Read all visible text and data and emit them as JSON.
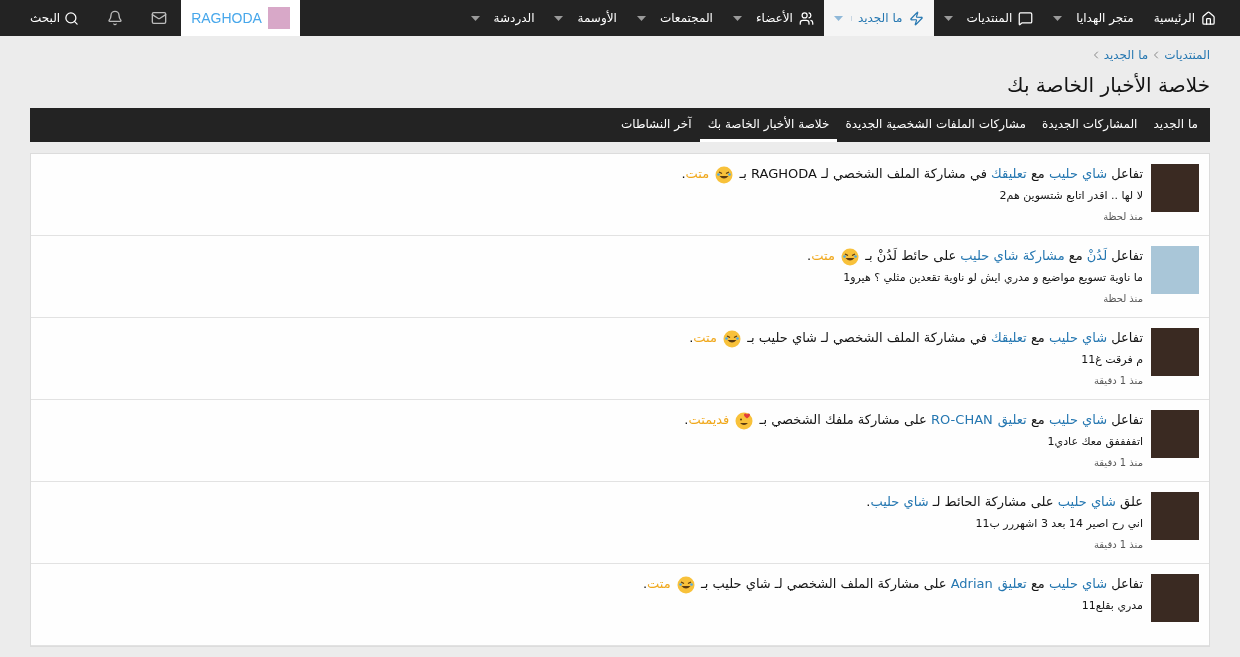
{
  "nav": {
    "items": [
      {
        "label": "الرئيسية",
        "kind": "home",
        "caret": false,
        "selected": false
      },
      {
        "label": "متجر الهدايا",
        "kind": "plain",
        "caret": true,
        "selected": false
      },
      {
        "label": "المنتديات",
        "kind": "forums",
        "caret": true,
        "selected": false
      },
      {
        "label": "ما الجديد",
        "kind": "new",
        "caret": true,
        "selected": true
      },
      {
        "label": "الأعضاء",
        "kind": "members",
        "caret": true,
        "selected": false
      },
      {
        "label": "المجتمعات",
        "kind": "plain",
        "caret": true,
        "selected": false
      },
      {
        "label": "الأوسمة",
        "kind": "plain",
        "caret": true,
        "selected": false
      },
      {
        "label": "الدردشة",
        "kind": "plain",
        "caret": true,
        "selected": false
      }
    ],
    "user": "RAGHODA",
    "search": "البحث"
  },
  "breadcrumbs": [
    "المنتديات",
    "ما الجديد"
  ],
  "title": "خلاصة الأخبار الخاصة بك",
  "tabs": [
    {
      "label": "ما الجديد",
      "selected": false
    },
    {
      "label": "المشاركات الجديدة",
      "selected": false
    },
    {
      "label": "مشاركات الملفات الشخصية الجديدة",
      "selected": false
    },
    {
      "label": "خلاصة الأخبار الخاصة بك",
      "selected": true
    },
    {
      "label": "آخر النشاطات",
      "selected": false
    }
  ],
  "feed": [
    {
      "parts": [
        {
          "kind": "plain",
          "text": "تفاعل "
        },
        {
          "kind": "link",
          "text": "شاي حليب"
        },
        {
          "kind": "plain",
          "text": " مع "
        },
        {
          "kind": "link",
          "text": "تعليقك"
        },
        {
          "kind": "plain",
          "text": " في مشاركة الملف الشخصي لـ RAGHODA بـ "
        },
        {
          "kind": "laugh-emoji"
        },
        {
          "kind": "reaction",
          "text": " متت"
        },
        {
          "kind": "plain",
          "text": "."
        }
      ],
      "snippet": "لا لها .. اقدر اتابع شتسوين هم2",
      "time": "منذ لحظة"
    },
    {
      "parts": [
        {
          "kind": "plain",
          "text": "تفاعل "
        },
        {
          "kind": "link",
          "text": "لَدُنْ"
        },
        {
          "kind": "plain",
          "text": " مع "
        },
        {
          "kind": "link",
          "text": "مشاركة شاي حليب"
        },
        {
          "kind": "plain",
          "text": " على حائط لَدُنْ بـ "
        },
        {
          "kind": "laugh-emoji"
        },
        {
          "kind": "reaction",
          "text": " متت"
        },
        {
          "kind": "plain",
          "text": "."
        }
      ],
      "snippet": "ما ناوية تسويع مواضيع و مدري ايش لو ناوية تقعدين مثلي ؟ هيرو1",
      "time": "منذ لحظة"
    },
    {
      "parts": [
        {
          "kind": "plain",
          "text": "تفاعل "
        },
        {
          "kind": "link",
          "text": "شاي حليب"
        },
        {
          "kind": "plain",
          "text": " مع "
        },
        {
          "kind": "link",
          "text": "تعليقك"
        },
        {
          "kind": "plain",
          "text": " في مشاركة الملف الشخصي لـ شاي حليب بـ "
        },
        {
          "kind": "laugh-emoji"
        },
        {
          "kind": "reaction",
          "text": " متت"
        },
        {
          "kind": "plain",
          "text": "."
        }
      ],
      "snippet": "م فرقت غ11",
      "time": "منذ 1 دقيقة"
    },
    {
      "parts": [
        {
          "kind": "plain",
          "text": "تفاعل "
        },
        {
          "kind": "link",
          "text": "شاي حليب"
        },
        {
          "kind": "plain",
          "text": " مع "
        },
        {
          "kind": "link",
          "text": "تعليق"
        },
        {
          "kind": "link",
          "text": "RO-CHAN"
        },
        {
          "kind": "plain",
          "text": " على مشاركة ملفك الشخصي بـ "
        },
        {
          "kind": "love-emoji"
        },
        {
          "kind": "reaction",
          "text": " فديمتت"
        },
        {
          "kind": "plain",
          "text": "."
        }
      ],
      "snippet": "اتففففق معك عادي1",
      "time": "منذ 1 دقيقة"
    },
    {
      "parts": [
        {
          "kind": "plain",
          "text": "علق "
        },
        {
          "kind": "link",
          "text": "شاي حليب"
        },
        {
          "kind": "plain",
          "text": " على مشاركة الحائط لـ "
        },
        {
          "kind": "link",
          "text": "شاي حليب"
        },
        {
          "kind": "plain",
          "text": "."
        }
      ],
      "snippet": "اني رح اصير 14 بعد 3 اشهررر ب11",
      "time": "منذ 1 دقيقة"
    },
    {
      "parts": [
        {
          "kind": "plain",
          "text": "تفاعل "
        },
        {
          "kind": "link",
          "text": "شاي حليب"
        },
        {
          "kind": "plain",
          "text": " مع "
        },
        {
          "kind": "link",
          "text": "تعليق"
        },
        {
          "kind": "link",
          "text": "Adrian"
        },
        {
          "kind": "plain",
          "text": " على مشاركة الملف الشخصي لـ شاي حليب بـ "
        },
        {
          "kind": "laugh-emoji"
        },
        {
          "kind": "reaction",
          "text": " متت"
        },
        {
          "kind": "plain",
          "text": "."
        }
      ],
      "snippet": "مدري بقلع11"
    }
  ]
}
